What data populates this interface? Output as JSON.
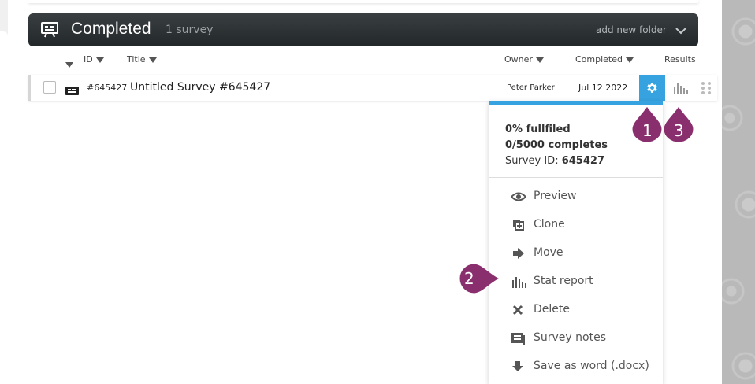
{
  "folder": {
    "title": "Completed",
    "count": "1 survey",
    "add_new_folder": "add new folder"
  },
  "columns": {
    "id": "ID",
    "title": "Title",
    "owner": "Owner",
    "completed": "Completed",
    "results": "Results"
  },
  "survey": {
    "id": "#645427",
    "title": "Untitled Survey #645427",
    "owner": "Peter Parker",
    "completed_date": "Jul 12 2022"
  },
  "menu": {
    "fulfilled": "0% fullfiled",
    "completes": "0/5000 completes",
    "survey_id_label": "Survey ID:",
    "survey_id_value": "645427",
    "items": [
      {
        "label": "Preview",
        "icon": "eye-icon"
      },
      {
        "label": "Clone",
        "icon": "clone-icon"
      },
      {
        "label": "Move",
        "icon": "arrow-right-icon"
      },
      {
        "label": "Stat report",
        "icon": "bar-chart-icon"
      },
      {
        "label": "Delete",
        "icon": "x-icon"
      },
      {
        "label": "Survey notes",
        "icon": "notes-icon"
      },
      {
        "label": "Save as word (.docx)",
        "icon": "download-icon"
      }
    ]
  },
  "callouts": [
    "1",
    "2",
    "3"
  ],
  "colors": {
    "accent": "#36a3e0",
    "header_bar": "#2b3033",
    "callout": "#8a2f6e"
  }
}
